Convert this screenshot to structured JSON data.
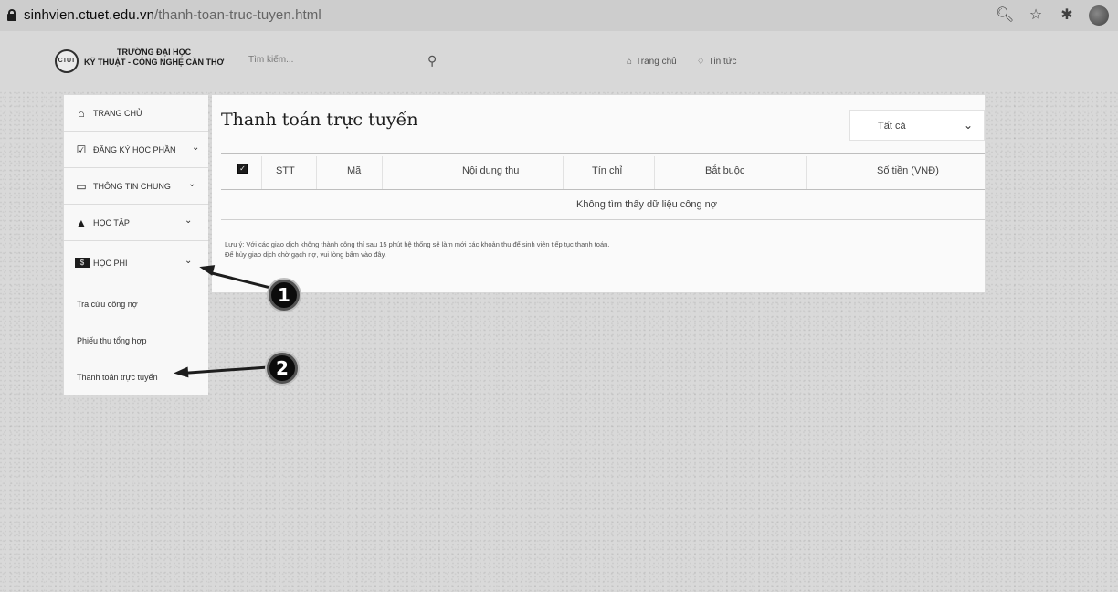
{
  "browser": {
    "url_domain": "sinhvien.ctuet.edu.vn",
    "url_path": "/thanh-toan-truc-tuyen.html",
    "icons": [
      "zoom-icon",
      "star-icon",
      "extensions-icon",
      "profile-avatar"
    ]
  },
  "site": {
    "logo_text": "CTUT",
    "school_line1": "TRƯỜNG ĐẠI HỌC",
    "school_line2": "KỸ THUẬT - CÔNG NGHỆ CẦN THƠ",
    "search_placeholder": "Tìm kiếm...",
    "nav": [
      {
        "label": "Trang chủ",
        "icon": "home-icon"
      },
      {
        "label": "Tin tức",
        "icon": "bell-icon"
      }
    ]
  },
  "sidebar": {
    "items": [
      {
        "label": "TRANG CHỦ",
        "icon": "home-icon",
        "has_chevron": false
      },
      {
        "label": "ĐĂNG KÝ HỌC PHẦN",
        "icon": "checkbox-icon",
        "has_chevron": true
      },
      {
        "label": "THÔNG TIN CHUNG",
        "icon": "monitor-icon",
        "has_chevron": true
      },
      {
        "label": "HỌC TẬP",
        "icon": "graduation-cap-icon",
        "has_chevron": true
      },
      {
        "label": "HỌC PHÍ",
        "icon": "money-icon",
        "has_chevron": true
      }
    ],
    "subitems": [
      "Tra cứu công nợ",
      "Phiếu thu tổng hợp",
      "Thanh toán trực tuyến"
    ]
  },
  "main": {
    "title": "Thanh toán trực tuyến",
    "filter_value": "Tất cả",
    "columns": [
      "STT",
      "Mã",
      "Nội dung thu",
      "Tín chỉ",
      "Bắt buộc",
      "Số tiền (VNĐ)"
    ],
    "empty_message": "Không tìm thấy dữ liệu công nợ",
    "note_line1": "Lưu ý: Với các giao dịch không thành công thì sau 15 phút hệ thống sẽ làm mới các khoản thu để sinh viên tiếp tục thanh toán.",
    "note_line2": "Để hủy giao dịch chờ gạch nợ, vui lòng bấm vào đây."
  },
  "annotations": {
    "badge1": "1",
    "badge2": "2"
  }
}
